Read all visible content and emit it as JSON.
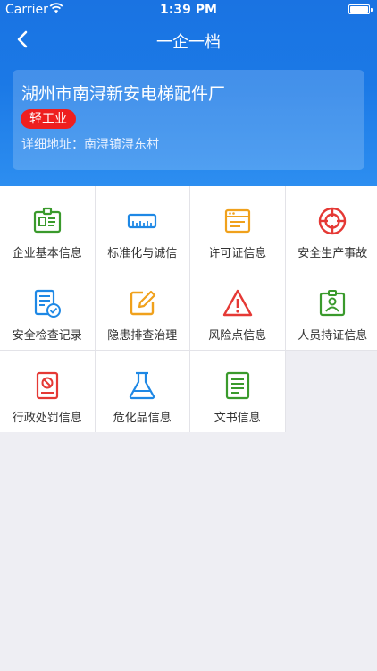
{
  "status_bar": {
    "carrier": "Carrier",
    "time": "1:39 PM"
  },
  "nav": {
    "title": "一企一档"
  },
  "company": {
    "name": "湖州市南浔新安电梯配件厂",
    "industry": "轻工业",
    "address_label": "详细地址：",
    "address": "南浔镇浔东村"
  },
  "menu": [
    {
      "label": "企业基本信息",
      "icon": "id-card-icon",
      "color": "#3a9a2c"
    },
    {
      "label": "标准化与诚信",
      "icon": "ruler-icon",
      "color": "#1e88e5"
    },
    {
      "label": "许可证信息",
      "icon": "license-window-icon",
      "color": "#f0a11c"
    },
    {
      "label": "安全生产事故",
      "icon": "target-icon",
      "color": "#e53935"
    },
    {
      "label": "安全检查记录",
      "icon": "inspection-doc-icon",
      "color": "#1e88e5"
    },
    {
      "label": "隐患排查治理",
      "icon": "edit-icon",
      "color": "#f0a11c"
    },
    {
      "label": "风险点信息",
      "icon": "warning-icon",
      "color": "#e53935"
    },
    {
      "label": "人员持证信息",
      "icon": "badge-person-icon",
      "color": "#3a9a2c"
    },
    {
      "label": "行政处罚信息",
      "icon": "prohibit-doc-icon",
      "color": "#e53935"
    },
    {
      "label": "危化品信息",
      "icon": "flask-icon",
      "color": "#1e88e5"
    },
    {
      "label": "文书信息",
      "icon": "document-icon",
      "color": "#3a9a2c"
    }
  ]
}
